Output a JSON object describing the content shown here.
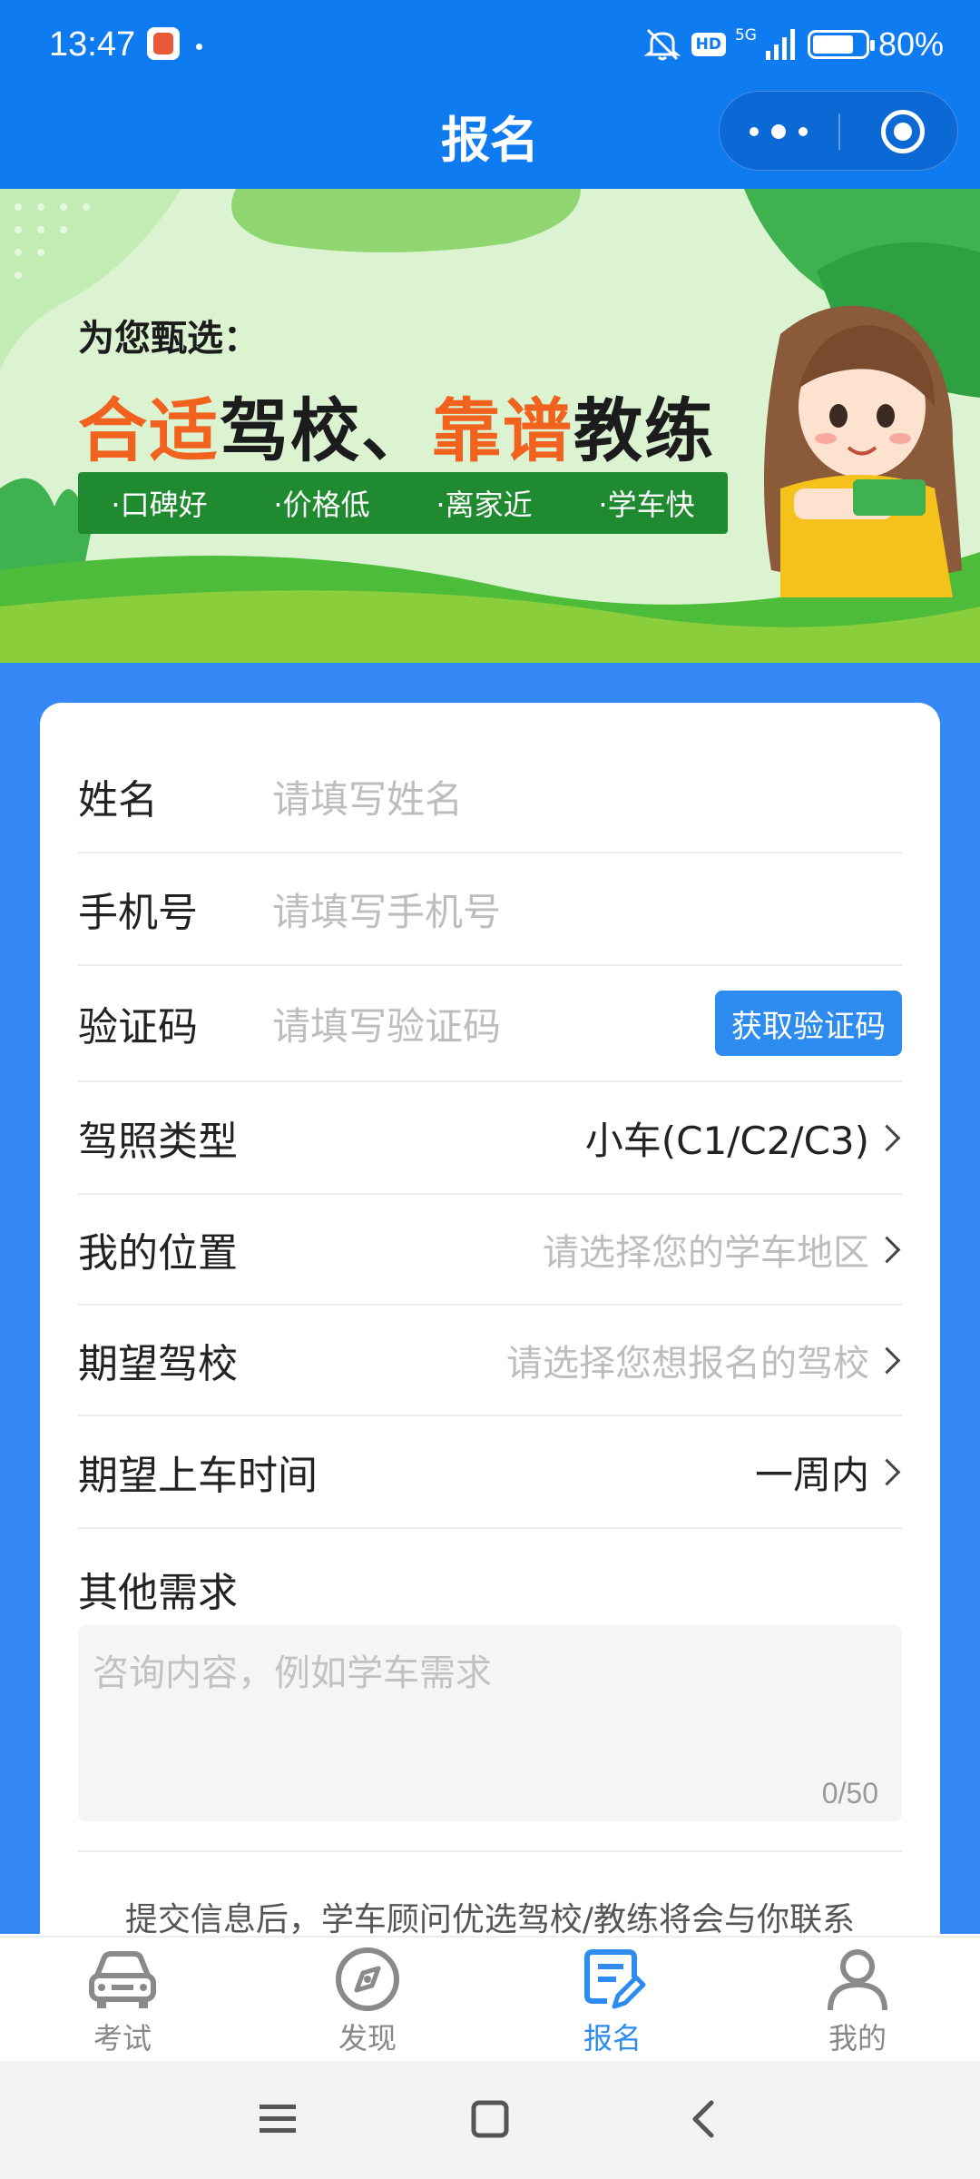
{
  "status_bar": {
    "time": "13:47",
    "hd": "HD",
    "network": "5G",
    "battery": "80%"
  },
  "nav": {
    "title": "报名"
  },
  "banner": {
    "subtitle": "为您甄选：",
    "headline": {
      "p1": "合适",
      "p2": "驾校、",
      "p3": "靠谱",
      "p4": "教练"
    },
    "tags": [
      "·口碑好",
      "·价格低",
      "·离家近",
      "·学车快"
    ]
  },
  "form": {
    "name": {
      "label": "姓名",
      "placeholder": "请填写姓名"
    },
    "phone": {
      "label": "手机号",
      "placeholder": "请填写手机号"
    },
    "code": {
      "label": "验证码",
      "placeholder": "请填写验证码",
      "button": "获取验证码"
    },
    "license": {
      "label": "驾照类型",
      "value": "小车(C1/C2/C3)"
    },
    "location": {
      "label": "我的位置",
      "placeholder": "请选择您的学车地区"
    },
    "school": {
      "label": "期望驾校",
      "placeholder": "请选择您想报名的驾校"
    },
    "start_time": {
      "label": "期望上车时间",
      "value": "一周内"
    },
    "other": {
      "label": "其他需求",
      "placeholder": "咨询内容，例如学车需求",
      "count": "0/50"
    }
  },
  "notice": "提交信息后，学车顾问优选驾校/教练将会与你联系",
  "tabbar": {
    "items": [
      {
        "label": "考试",
        "icon": "car-icon",
        "active": false
      },
      {
        "label": "发现",
        "icon": "compass-icon",
        "active": false
      },
      {
        "label": "报名",
        "icon": "edit-form-icon",
        "active": true
      },
      {
        "label": "我的",
        "icon": "user-icon",
        "active": false
      }
    ]
  },
  "colors": {
    "primary": "#0f7bf0",
    "page_bg": "#3388f6",
    "accent_orange": "#f0621e",
    "banner_green": "#1f8a30"
  }
}
